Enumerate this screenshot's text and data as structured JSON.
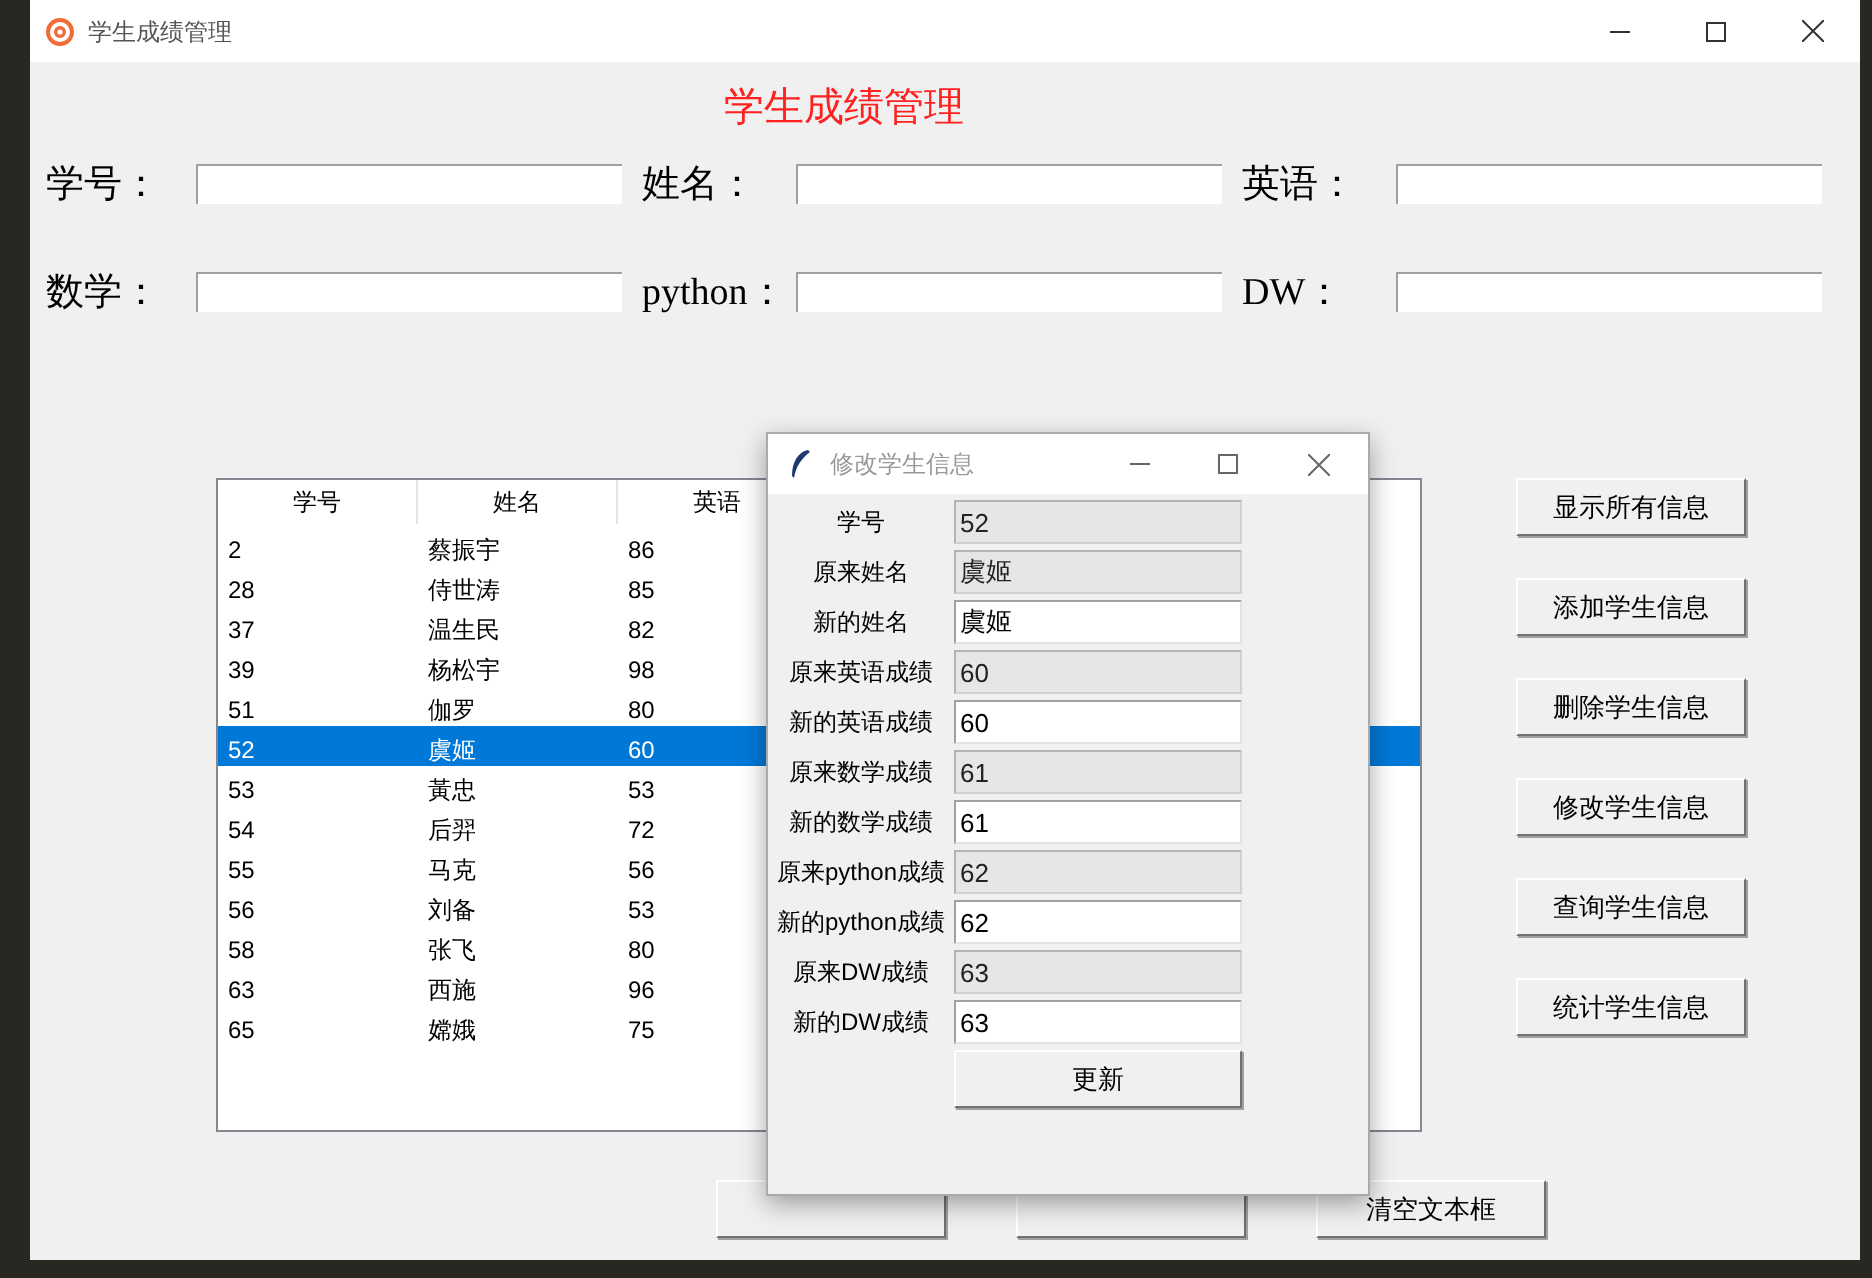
{
  "window": {
    "title": "学生成绩管理"
  },
  "heading": "学生成绩管理",
  "form_fields": [
    {
      "label": "学号："
    },
    {
      "label": "姓名："
    },
    {
      "label": "英语："
    },
    {
      "label": "数学："
    },
    {
      "label": "python："
    },
    {
      "label": "DW："
    }
  ],
  "table": {
    "columns": [
      "学号",
      "姓名",
      "英语"
    ],
    "rows": [
      {
        "cells": [
          "2",
          "蔡振宇",
          "86"
        ],
        "selected": false
      },
      {
        "cells": [
          "28",
          "侍世涛",
          "85"
        ],
        "selected": false
      },
      {
        "cells": [
          "37",
          "温生民",
          "82"
        ],
        "selected": false
      },
      {
        "cells": [
          "39",
          "杨松宇",
          "98"
        ],
        "selected": false
      },
      {
        "cells": [
          "51",
          "伽罗",
          "80"
        ],
        "selected": false
      },
      {
        "cells": [
          "52",
          "虞姬",
          "60"
        ],
        "selected": true
      },
      {
        "cells": [
          "53",
          "黃忠",
          "53"
        ],
        "selected": false
      },
      {
        "cells": [
          "54",
          "后羿",
          "72"
        ],
        "selected": false
      },
      {
        "cells": [
          "55",
          "马克",
          "56"
        ],
        "selected": false
      },
      {
        "cells": [
          "56",
          "刘备",
          "53"
        ],
        "selected": false
      },
      {
        "cells": [
          "58",
          "张飞",
          "80"
        ],
        "selected": false
      },
      {
        "cells": [
          "63",
          "西施",
          "96"
        ],
        "selected": false
      },
      {
        "cells": [
          "65",
          "嫦娥",
          "75"
        ],
        "selected": false
      }
    ]
  },
  "side_buttons": [
    "显示所有信息",
    "添加学生信息",
    "删除学生信息",
    "修改学生信息",
    "查询学生信息",
    "统计学生信息"
  ],
  "bottom_buttons": [
    {
      "kind": "covered"
    },
    {
      "kind": "covered"
    },
    {
      "kind": "labeled",
      "label": "清空文本框"
    }
  ],
  "dialog": {
    "title": "修改学生信息",
    "rows": [
      {
        "label": "学号",
        "value": "52",
        "editable": false
      },
      {
        "label": "原来姓名",
        "value": "虞姬",
        "editable": false
      },
      {
        "label": "新的姓名",
        "value": "虞姬",
        "editable": true
      },
      {
        "label": "原来英语成绩",
        "value": "60",
        "editable": false
      },
      {
        "label": "新的英语成绩",
        "value": "60",
        "editable": true
      },
      {
        "label": "原来数学成绩",
        "value": "61",
        "editable": false
      },
      {
        "label": "新的数学成绩",
        "value": "61",
        "editable": true
      },
      {
        "label": "原来python成绩",
        "value": "62",
        "editable": false
      },
      {
        "label": "新的python成绩",
        "value": "62",
        "editable": true
      },
      {
        "label": "原来DW成绩",
        "value": "63",
        "editable": false
      },
      {
        "label": "新的DW成绩",
        "value": "63",
        "editable": true
      }
    ],
    "button": "更新"
  }
}
